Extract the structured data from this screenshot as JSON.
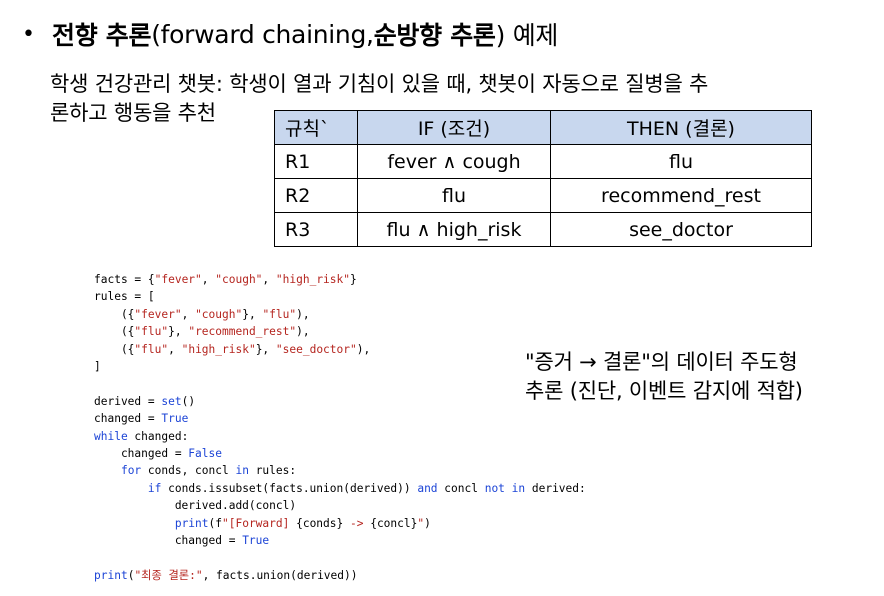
{
  "title": {
    "bullet": "•",
    "bold1": "전향 추론",
    "plain1": "(forward chaining, ",
    "bold2": "순방향 추론",
    "plain2": ") 예제"
  },
  "description": {
    "line1": "학생 건강관리 챗봇: 학생이 열과 기침이 있을 때, 챗봇이 자동으로 질병을 추",
    "line2": "론하고 행동을 추천"
  },
  "rules_table": {
    "headers": [
      "규칙`",
      "IF (조건)",
      "THEN (결론)"
    ],
    "rows": [
      [
        "R1",
        "fever ∧ cough",
        "flu"
      ],
      [
        "R2",
        "flu",
        "recommend_rest"
      ],
      [
        "R3",
        "flu ∧ high_risk",
        "see_doctor"
      ]
    ]
  },
  "side_note": {
    "line1": "\"증거 → 결론\"의 데이터 주도형",
    "line2": "추론 (진단, 이벤트 감지에 적합)"
  },
  "code_lines": [
    [
      {
        "t": "facts = {"
      },
      {
        "t": "\"fever\"",
        "c": "str"
      },
      {
        "t": ", "
      },
      {
        "t": "\"cough\"",
        "c": "str"
      },
      {
        "t": ", "
      },
      {
        "t": "\"high_risk\"",
        "c": "str"
      },
      {
        "t": "}"
      }
    ],
    [
      {
        "t": "rules = ["
      }
    ],
    [
      {
        "t": "    ({"
      },
      {
        "t": "\"fever\"",
        "c": "str"
      },
      {
        "t": ", "
      },
      {
        "t": "\"cough\"",
        "c": "str"
      },
      {
        "t": "}, "
      },
      {
        "t": "\"flu\"",
        "c": "str"
      },
      {
        "t": "),"
      }
    ],
    [
      {
        "t": "    ({"
      },
      {
        "t": "\"flu\"",
        "c": "str"
      },
      {
        "t": "}, "
      },
      {
        "t": "\"recommend_rest\"",
        "c": "str"
      },
      {
        "t": "),"
      }
    ],
    [
      {
        "t": "    ({"
      },
      {
        "t": "\"flu\"",
        "c": "str"
      },
      {
        "t": ", "
      },
      {
        "t": "\"high_risk\"",
        "c": "str"
      },
      {
        "t": "}, "
      },
      {
        "t": "\"see_doctor\"",
        "c": "str"
      },
      {
        "t": "),"
      }
    ],
    [
      {
        "t": "]"
      }
    ],
    [
      {
        "t": ""
      }
    ],
    [
      {
        "t": "derived = "
      },
      {
        "t": "set",
        "c": "kw"
      },
      {
        "t": "()"
      }
    ],
    [
      {
        "t": "changed = "
      },
      {
        "t": "True",
        "c": "kw"
      }
    ],
    [
      {
        "t": "while",
        "c": "kw"
      },
      {
        "t": " changed:"
      }
    ],
    [
      {
        "t": "    changed = "
      },
      {
        "t": "False",
        "c": "kw"
      }
    ],
    [
      {
        "t": "    "
      },
      {
        "t": "for",
        "c": "kw"
      },
      {
        "t": " conds, concl "
      },
      {
        "t": "in",
        "c": "kw"
      },
      {
        "t": " rules:"
      }
    ],
    [
      {
        "t": "        "
      },
      {
        "t": "if",
        "c": "kw"
      },
      {
        "t": " conds.issubset(facts.union(derived)) "
      },
      {
        "t": "and",
        "c": "kw"
      },
      {
        "t": " concl "
      },
      {
        "t": "not in",
        "c": "kw"
      },
      {
        "t": " derived:"
      }
    ],
    [
      {
        "t": "            derived.add(concl)"
      }
    ],
    [
      {
        "t": "            "
      },
      {
        "t": "print",
        "c": "kw"
      },
      {
        "t": "(f"
      },
      {
        "t": "\"[Forward] ",
        "c": "str"
      },
      {
        "t": "{conds} "
      },
      {
        "t": "-> ",
        "c": "str"
      },
      {
        "t": "{concl}"
      },
      {
        "t": "\"",
        "c": "str"
      },
      {
        "t": ")"
      }
    ],
    [
      {
        "t": "            changed = "
      },
      {
        "t": "True",
        "c": "kw"
      }
    ],
    [
      {
        "t": ""
      }
    ],
    [
      {
        "t": "print",
        "c": "kw"
      },
      {
        "t": "("
      },
      {
        "t": "\"최종 결론:\"",
        "c": "str"
      },
      {
        "t": ", facts.union(derived))"
      }
    ]
  ]
}
